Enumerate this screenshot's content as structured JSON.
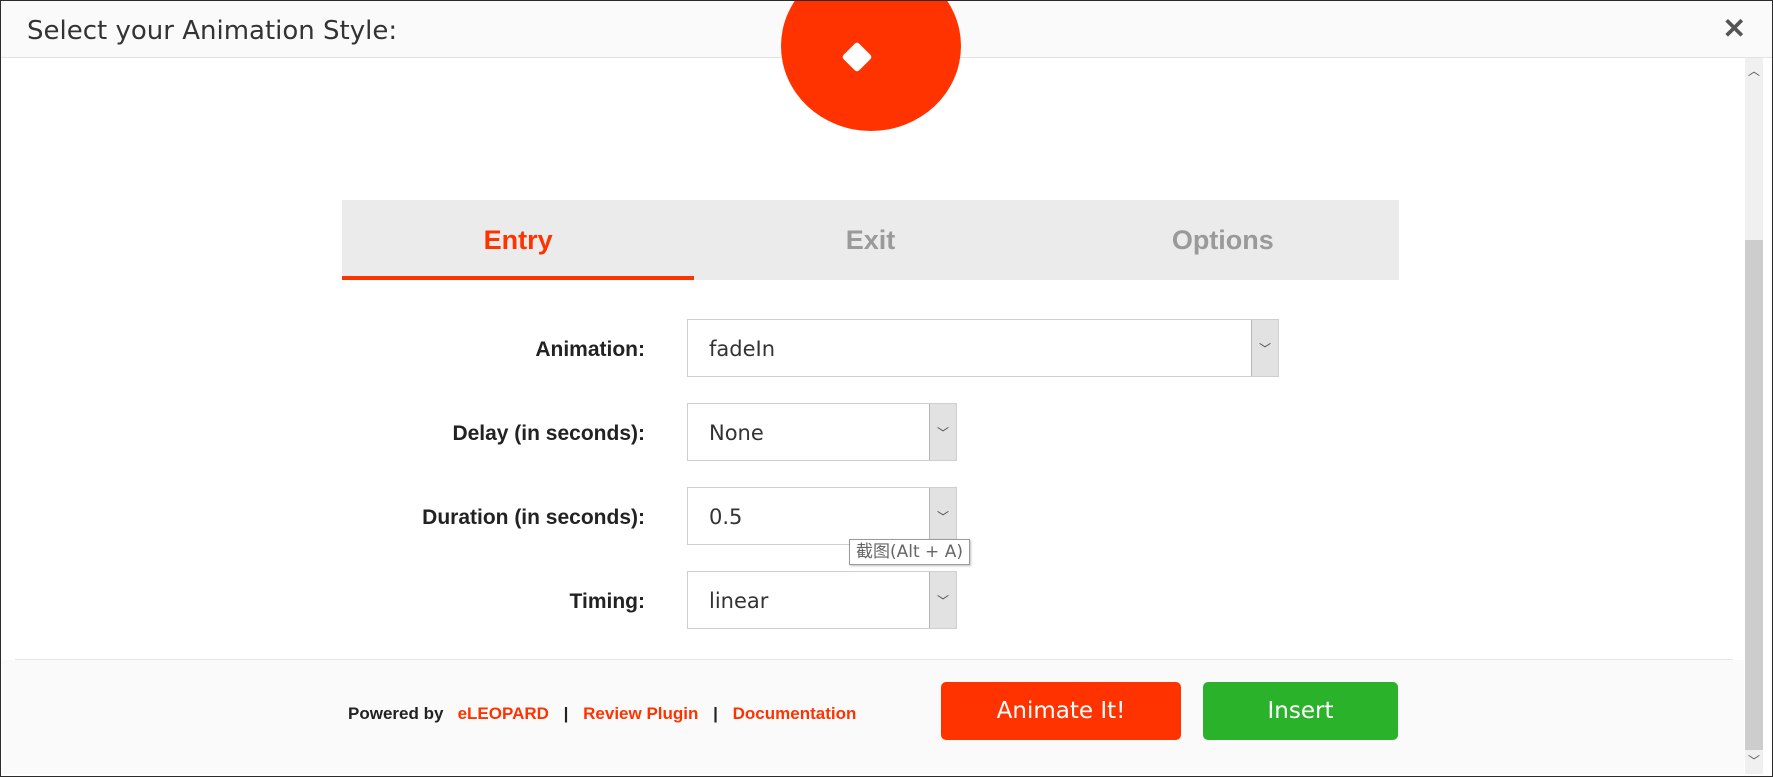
{
  "dialog": {
    "title": "Select your Animation Style:",
    "close_icon": "close-icon"
  },
  "preview": {
    "color": "#ff3300"
  },
  "tabs": [
    {
      "label": "Entry",
      "active": true
    },
    {
      "label": "Exit",
      "active": false
    },
    {
      "label": "Options",
      "active": false
    }
  ],
  "form": {
    "animation": {
      "label": "Animation:",
      "value": "fadeIn"
    },
    "delay": {
      "label": "Delay (in seconds):",
      "value": "None"
    },
    "duration": {
      "label": "Duration (in seconds):",
      "value": "0.5"
    },
    "timing": {
      "label": "Timing:",
      "value": "linear"
    }
  },
  "tooltip": {
    "text": "截图(Alt + A)"
  },
  "footer": {
    "powered_by": "Powered by",
    "brand_link": "eLEOPARD",
    "separator": "|",
    "review_link": "Review Plugin",
    "docs_link": "Documentation",
    "animate_button": "Animate It!",
    "insert_button": "Insert"
  },
  "colors": {
    "accent": "#ff3300",
    "insert": "#29b22a"
  }
}
